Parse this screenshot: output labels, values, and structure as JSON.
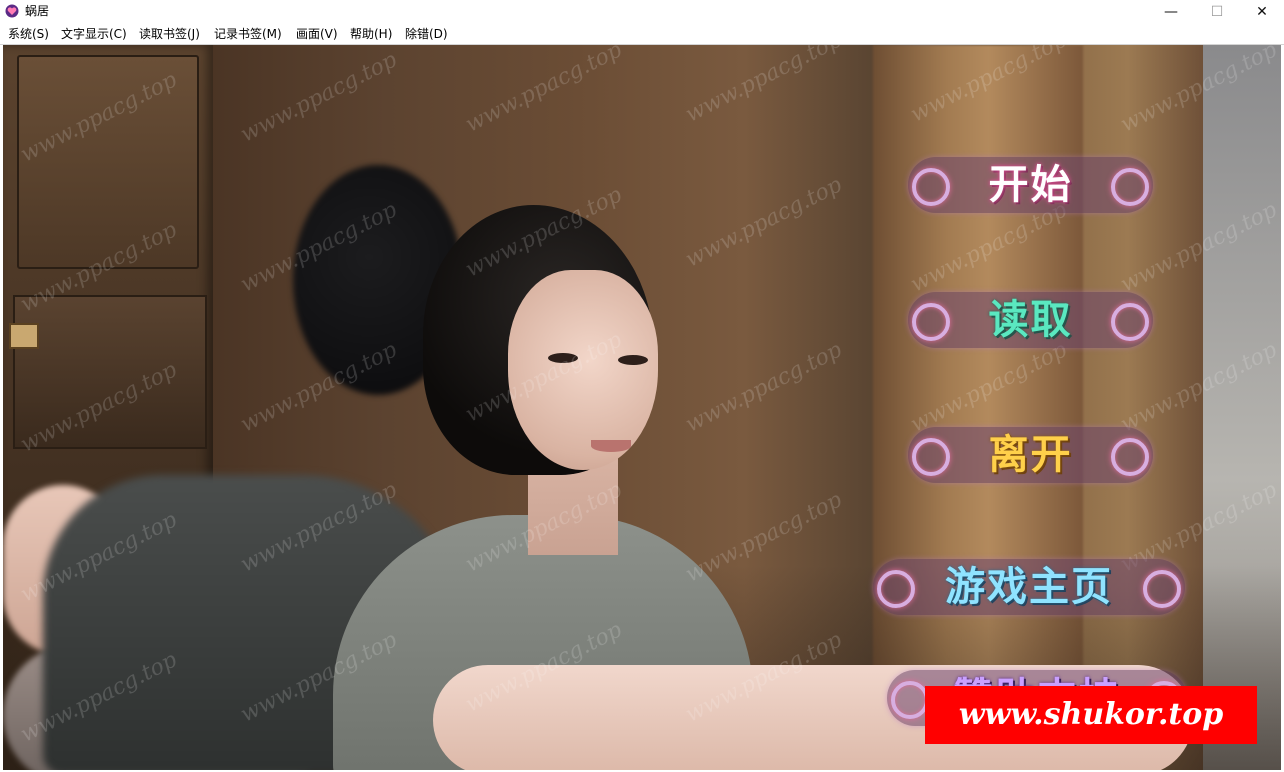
{
  "window": {
    "title": "蜗居",
    "icon": "heart-app-icon",
    "controls": {
      "minimize": "—",
      "maximize": "☐",
      "close": "✕"
    }
  },
  "menubar": {
    "items": [
      "系统(S)",
      "文字显示(C)",
      "读取书签(J)",
      "记录书签(M)",
      "画面(V)",
      "帮助(H)",
      "除错(D)"
    ]
  },
  "main_menu": {
    "start": "开始",
    "load": "读取",
    "exit": "离开",
    "homepage": "游戏主页",
    "support": "赞助支持"
  },
  "watermark": "www.ppacg.top",
  "banner": "www.shukor.top",
  "colors": {
    "start_text": "#ffffff",
    "load_text": "#5ae8c0",
    "exit_text": "#ffd04a",
    "homepage_text": "#8fe3ff",
    "banner_bg": "#ff0000"
  }
}
